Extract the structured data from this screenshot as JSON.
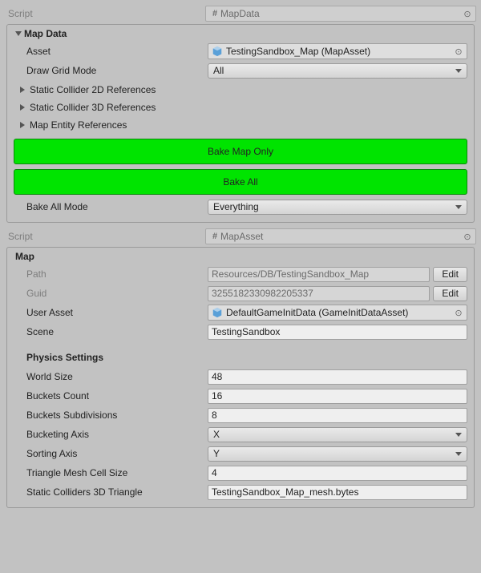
{
  "component1": {
    "script_label": "Script",
    "script_value": "MapData",
    "section_title": "Map Data",
    "asset_label": "Asset",
    "asset_value": "TestingSandbox_Map (MapAsset)",
    "draw_grid_label": "Draw Grid Mode",
    "draw_grid_value": "All",
    "foldouts": {
      "c2d": "Static Collider 2D References",
      "c3d": "Static Collider 3D References",
      "ent": "Map Entity References"
    },
    "btn_bake_map": "Bake Map Only",
    "btn_bake_all": "Bake All",
    "bake_mode_label": "Bake All Mode",
    "bake_mode_value": "Everything"
  },
  "component2": {
    "script_label": "Script",
    "script_value": "MapAsset",
    "section_title": "Map",
    "path_label": "Path",
    "path_value": "Resources/DB/TestingSandbox_Map",
    "guid_label": "Guid",
    "guid_value": "3255182330982205337",
    "edit_label": "Edit",
    "user_asset_label": "User Asset",
    "user_asset_value": "DefaultGameInitData (GameInitDataAsset)",
    "scene_label": "Scene",
    "scene_value": "TestingSandbox",
    "physics_header": "Physics Settings",
    "world_size_label": "World Size",
    "world_size_value": "48",
    "buckets_count_label": "Buckets Count",
    "buckets_count_value": "16",
    "buckets_subdiv_label": "Buckets Subdivisions",
    "buckets_subdiv_value": "8",
    "bucketing_axis_label": "Bucketing Axis",
    "bucketing_axis_value": "X",
    "sorting_axis_label": "Sorting Axis",
    "sorting_axis_value": "Y",
    "trimesh_cell_label": "Triangle Mesh Cell Size",
    "trimesh_cell_value": "4",
    "static3d_label": "Static Colliders 3D Triangle",
    "static3d_value": "TestingSandbox_Map_mesh.bytes"
  }
}
